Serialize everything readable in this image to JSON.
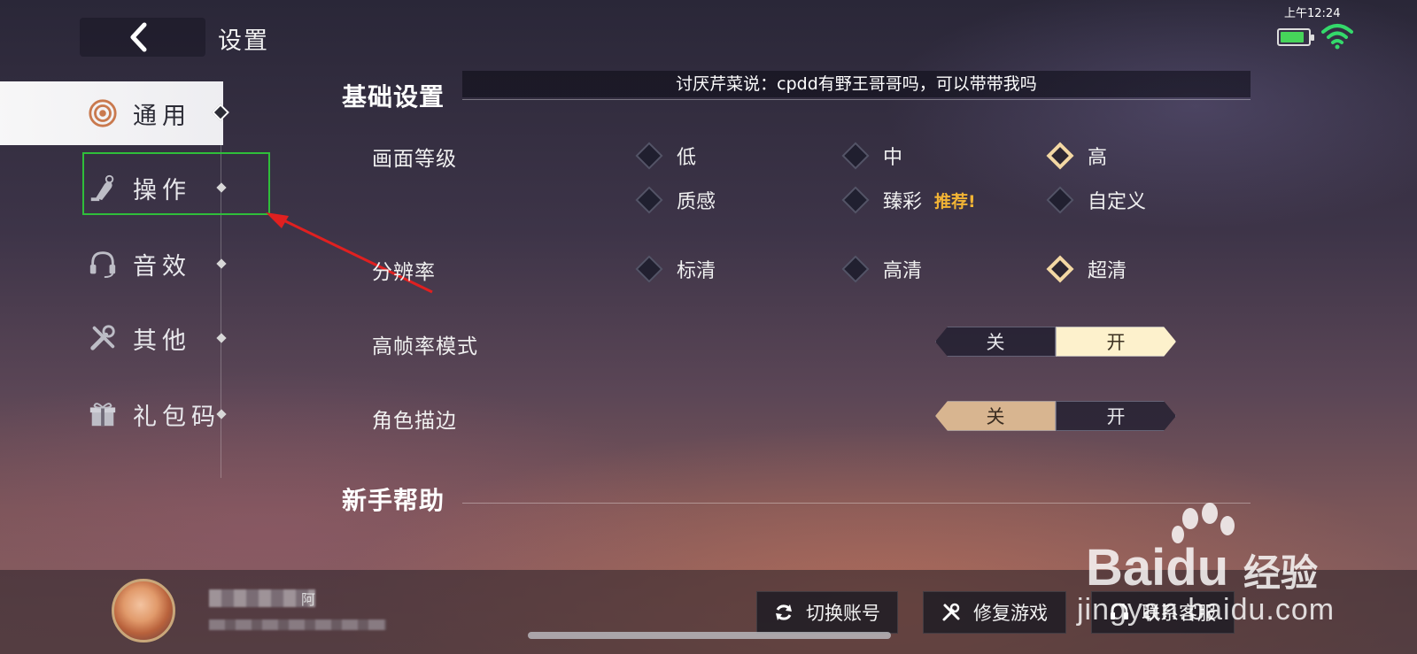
{
  "status_bar": {
    "time": "上午12:24",
    "battery_level": 0.75
  },
  "header": {
    "title": "设置"
  },
  "sidebar": {
    "items": [
      {
        "label": "通用",
        "active": true
      },
      {
        "label": "操作",
        "active": false
      },
      {
        "label": "音效",
        "active": false
      },
      {
        "label": "其他",
        "active": false
      },
      {
        "label": "礼包码",
        "active": false
      }
    ]
  },
  "marquee": {
    "text": "讨厌芹菜说：cpdd有野王哥哥吗，可以带带我吗"
  },
  "basic_settings": {
    "heading": "基础设置",
    "graphics_level": {
      "label": "画面等级",
      "options": [
        "低",
        "中",
        "高",
        "质感",
        "臻彩",
        "自定义"
      ],
      "selected": "高",
      "badge": "推荐!"
    },
    "resolution": {
      "label": "分辨率",
      "options": [
        "标清",
        "高清",
        "超清"
      ],
      "selected": "超清"
    },
    "high_fps": {
      "label": "高帧率模式",
      "off": "关",
      "on": "开",
      "value": "开"
    },
    "outline": {
      "label": "角色描边",
      "off": "关",
      "on": "开",
      "value": "关"
    }
  },
  "help": {
    "heading": "新手帮助"
  },
  "footer": {
    "user_name_suffix": "阿",
    "buttons": {
      "switch_account": "切换账号",
      "repair_game": "修复游戏",
      "contact_support": "联系客服"
    }
  },
  "watermark": {
    "brand": "Bai",
    "brand_du": "du",
    "product": "经验",
    "url": "jingyan.baidu.com"
  },
  "colors": {
    "accent_selected": "#f3d8a4",
    "badge": "#f2b435",
    "highlight_box": "#2fbe3a",
    "arrow": "#e02020"
  }
}
